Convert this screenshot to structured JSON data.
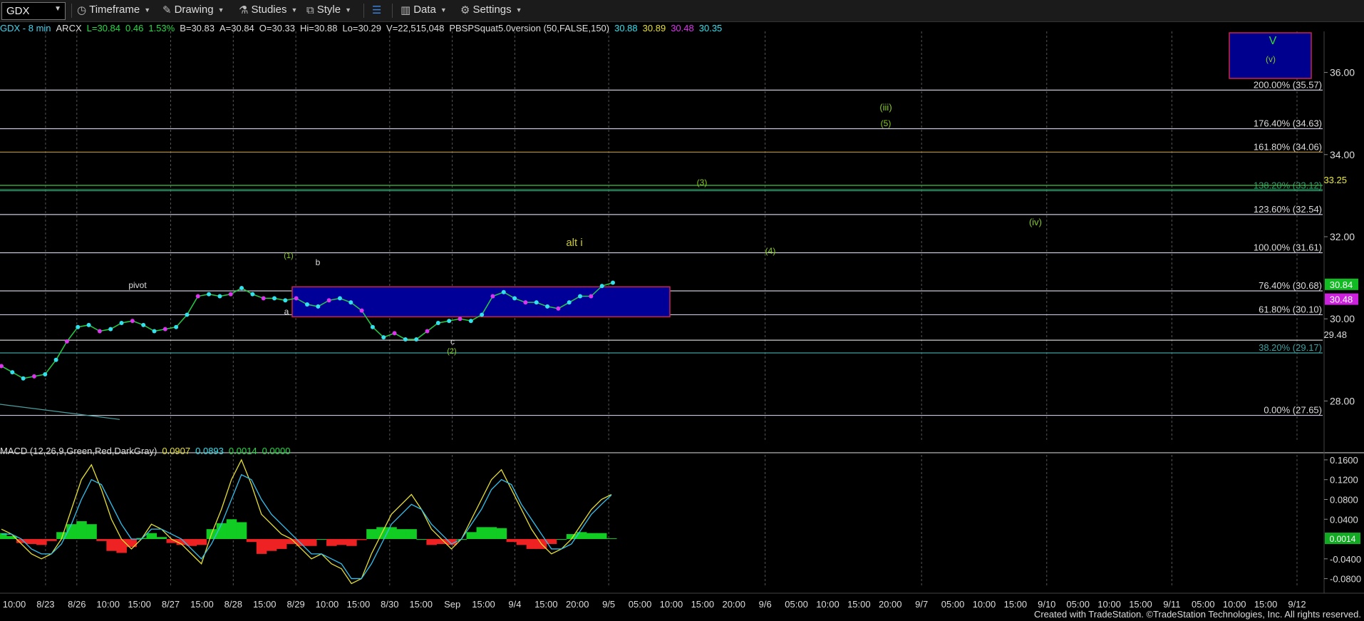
{
  "toolbar": {
    "symbol": "GDX",
    "timeframe_label": "Timeframe",
    "drawing_label": "Drawing",
    "studies_label": "Studies",
    "style_label": "Style",
    "data_label": "Data",
    "settings_label": "Settings"
  },
  "info_bar": {
    "symbol_interval": "GDX - 8 min",
    "exchange": "ARCX",
    "last": "L=30.84",
    "change": "0.46",
    "change_pct": "1.53%",
    "bid": "B=30.83",
    "ask": "A=30.84",
    "open": "O=30.33",
    "high": "Hi=30.88",
    "low": "Lo=30.29",
    "volume": "V=22,515,048",
    "indicator_name": "PBSPSquat5.0version (50,FALSE,150)",
    "ind_v1": "30.88",
    "ind_v2": "30.89",
    "ind_v3": "30.48",
    "ind_v4": "30.35"
  },
  "macd_bar": {
    "label": "MACD (12,26,9,Green,Red,DarkGray)",
    "v1": "0.0907",
    "v2": "0.0893",
    "v3": "0.0014",
    "v4": "0.0000"
  },
  "footer": "Created with TradeStation. ©TradeStation Technologies, Inc. All rights reserved.",
  "colors": {
    "bg": "#000000",
    "grid": "#2a2a2a",
    "fib": "#c8c8d8",
    "price_green": "#22cc44",
    "cyan": "#33e0ee",
    "magenta": "#dd33ee",
    "box_fill": "#000099",
    "box_border": "#cc2244",
    "wave_green": "#88cc22",
    "alt_yellow": "#cccc22",
    "macd_pos": "#11cc22",
    "macd_neg": "#ee2222"
  },
  "chart_data": [
    {
      "type": "line",
      "panel": "price",
      "y_axis_ticks": [
        "36.00",
        "34.00",
        "32.00",
        "30.00",
        "28.00"
      ],
      "ylim": [
        27.0,
        37.0
      ],
      "x_tick_labels": [
        "10:00",
        "8/23",
        "8/26",
        "10:00",
        "15:00",
        "8/27",
        "15:00",
        "8/28",
        "15:00",
        "8/29",
        "10:00",
        "15:00",
        "8/30",
        "15:00",
        "Sep",
        "15:00",
        "9/4",
        "15:00",
        "20:00",
        "9/5",
        "05:00",
        "10:00",
        "15:00",
        "20:00",
        "9/6",
        "05:00",
        "10:00",
        "15:00",
        "20:00",
        "9/7",
        "05:00",
        "10:00",
        "15:00",
        "9/10",
        "05:00",
        "10:00",
        "15:00",
        "9/11",
        "05:00",
        "10:00",
        "15:00",
        "9/12"
      ],
      "fib_levels": [
        {
          "label": "200.00% (35.57)",
          "value": 35.57
        },
        {
          "label": "176.40% (34.63)",
          "value": 34.63
        },
        {
          "label": "161.80% (34.06)",
          "value": 34.06
        },
        {
          "label": "138.20% (33.12)",
          "value": 33.12
        },
        {
          "label": "123.60% (32.54)",
          "value": 32.54
        },
        {
          "label": "100.00% (31.61)",
          "value": 31.61
        },
        {
          "label": "76.40% (30.68)",
          "value": 30.68
        },
        {
          "label": "61.80% (30.10)",
          "value": 30.1
        },
        {
          "label": "38.20% (29.17)",
          "value": 29.17
        },
        {
          "label": "0.00% (27.65)",
          "value": 27.65
        }
      ],
      "other_levels": [
        {
          "label": "33.25",
          "value": 33.25
        },
        {
          "label": "29.48",
          "value": 29.48
        }
      ],
      "price_tags": [
        {
          "label": "30.84",
          "value": 30.84,
          "color": "#11bb22"
        },
        {
          "label": "30.48",
          "value": 30.48,
          "color": "#cc22dd"
        }
      ],
      "wave_labels": [
        {
          "text": "V",
          "color": "#33dd33"
        },
        {
          "text": "(v)",
          "color": "#88cc22"
        },
        {
          "text": "(iii)",
          "color": "#88cc22"
        },
        {
          "text": "(5)",
          "color": "#88cc22"
        },
        {
          "text": "(3)",
          "color": "#88cc22"
        },
        {
          "text": "(iv)",
          "color": "#88cc22"
        },
        {
          "text": "(4)",
          "color": "#88cc22"
        },
        {
          "text": "alt i",
          "color": "#cccc22"
        },
        {
          "text": "(1)",
          "color": "#88cc22"
        },
        {
          "text": "b",
          "color": "#dddddd"
        },
        {
          "text": "pivot",
          "color": "#dddddd"
        },
        {
          "text": "a",
          "color": "#dddddd"
        },
        {
          "text": "c",
          "color": "#dddddd"
        },
        {
          "text": "(2)",
          "color": "#88cc22"
        }
      ],
      "series": [
        {
          "name": "GDX",
          "values": [
            28.85,
            28.7,
            28.55,
            28.6,
            28.65,
            29.0,
            29.45,
            29.8,
            29.85,
            29.7,
            29.75,
            29.9,
            29.95,
            29.85,
            29.7,
            29.75,
            29.8,
            30.1,
            30.55,
            30.6,
            30.55,
            30.6,
            30.75,
            30.6,
            30.5,
            30.5,
            30.45,
            30.5,
            30.35,
            30.3,
            30.45,
            30.5,
            30.4,
            30.2,
            29.8,
            29.55,
            29.65,
            29.5,
            29.5,
            29.7,
            29.9,
            29.95,
            30.0,
            29.95,
            30.1,
            30.55,
            30.65,
            30.5,
            30.4,
            30.4,
            30.3,
            30.25,
            30.4,
            30.55,
            30.55,
            30.8,
            30.88
          ]
        }
      ]
    },
    {
      "type": "bar",
      "panel": "macd",
      "y_axis_ticks": [
        "0.1600",
        "0.1200",
        "0.0800",
        "0.0400",
        "0.0014",
        "-0.0400",
        "-0.0800"
      ],
      "ylim": [
        -0.095,
        0.17
      ],
      "series": [
        {
          "name": "MACD",
          "values": [
            0.02,
            0.01,
            -0.01,
            -0.03,
            -0.04,
            -0.03,
            0.0,
            0.06,
            0.12,
            0.15,
            0.1,
            0.04,
            0.0,
            -0.02,
            0.0,
            0.03,
            0.02,
            0.0,
            -0.01,
            -0.03,
            -0.05,
            0.01,
            0.06,
            0.12,
            0.16,
            0.11,
            0.05,
            0.03,
            0.01,
            0.0,
            -0.02,
            -0.04,
            -0.03,
            -0.05,
            -0.06,
            -0.09,
            -0.08,
            -0.03,
            0.01,
            0.05,
            0.07,
            0.09,
            0.06,
            0.02,
            0.0,
            -0.02,
            0.0,
            0.04,
            0.08,
            0.12,
            0.14,
            0.1,
            0.06,
            0.02,
            -0.01,
            -0.03,
            -0.02,
            0.0,
            0.03,
            0.06,
            0.08,
            0.09
          ]
        },
        {
          "name": "Signal",
          "values": [
            0.01,
            0.01,
            0.0,
            -0.02,
            -0.03,
            -0.03,
            -0.01,
            0.03,
            0.08,
            0.12,
            0.11,
            0.07,
            0.03,
            0.0,
            0.0,
            0.02,
            0.02,
            0.01,
            0.0,
            -0.02,
            -0.04,
            -0.01,
            0.03,
            0.08,
            0.13,
            0.12,
            0.08,
            0.05,
            0.03,
            0.01,
            -0.01,
            -0.03,
            -0.03,
            -0.04,
            -0.05,
            -0.08,
            -0.08,
            -0.05,
            -0.01,
            0.03,
            0.05,
            0.07,
            0.06,
            0.03,
            0.01,
            -0.01,
            0.0,
            0.03,
            0.06,
            0.1,
            0.12,
            0.11,
            0.07,
            0.04,
            0.01,
            -0.02,
            -0.02,
            -0.01,
            0.02,
            0.05,
            0.07,
            0.089
          ]
        },
        {
          "name": "Hist",
          "values": [
            0.012,
            0.006,
            -0.008,
            -0.01,
            -0.012,
            -0.004,
            0.014,
            0.03,
            0.036,
            0.03,
            -0.004,
            -0.024,
            -0.028,
            -0.016,
            0.002,
            0.012,
            0.004,
            -0.008,
            -0.012,
            -0.014,
            -0.012,
            0.02,
            0.032,
            0.04,
            0.034,
            -0.006,
            -0.03,
            -0.024,
            -0.02,
            -0.01,
            -0.014,
            -0.014,
            0.0,
            -0.014,
            -0.012,
            -0.014,
            -0.002,
            0.02,
            0.024,
            0.024,
            0.02,
            0.02,
            0.0,
            -0.012,
            -0.01,
            -0.012,
            0.0,
            0.014,
            0.024,
            0.024,
            0.022,
            -0.006,
            -0.012,
            -0.02,
            -0.02,
            -0.01,
            0.0,
            0.01,
            0.014,
            0.012,
            0.012,
            0.0014
          ]
        }
      ]
    }
  ]
}
